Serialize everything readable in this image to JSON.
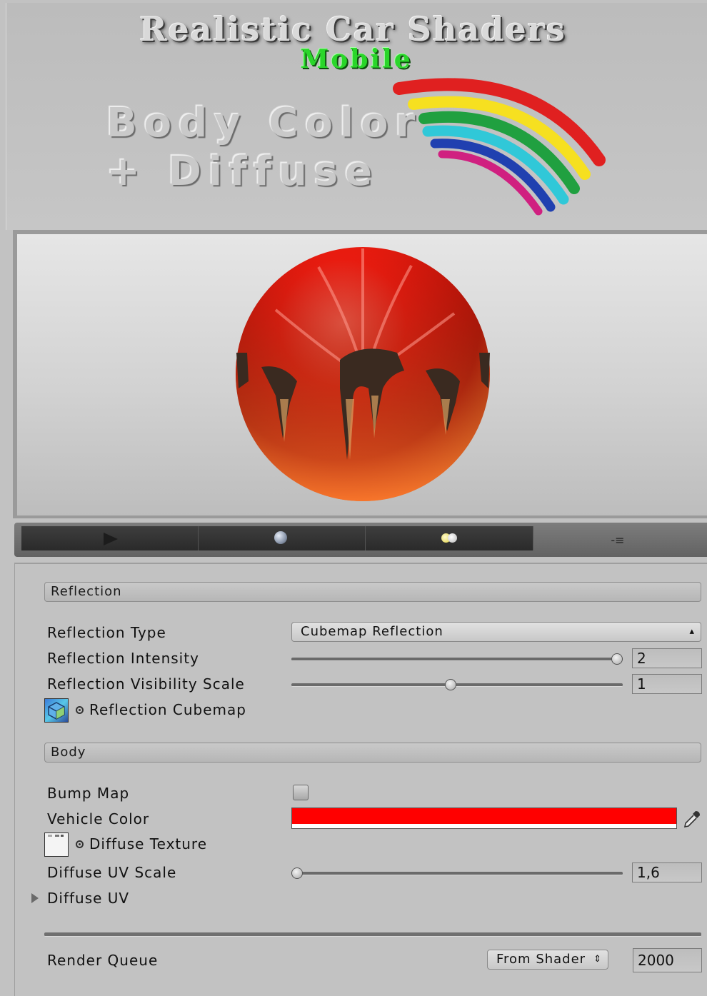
{
  "banner": {
    "title": "Realistic Car Shaders",
    "subtitle": "Mobile",
    "line1": "Body Color",
    "line2": "+ Diffuse"
  },
  "preview": {
    "toolbar": {
      "play": "play-icon",
      "sphere": "sphere-preview-icon",
      "lights": "lights-icon",
      "menu": "-≡"
    }
  },
  "inspector": {
    "reflection_section": "Reflection",
    "reflection_type_label": "Reflection Type",
    "reflection_type_value": "Cubemap Reflection",
    "reflection_intensity_label": "Reflection Intensity",
    "reflection_intensity_value": "2",
    "reflection_intensity_fraction": 1.0,
    "reflection_visibility_label": "Reflection Visibility Scale",
    "reflection_visibility_value": "1",
    "reflection_visibility_fraction": 0.48,
    "reflection_cubemap_label": "Reflection Cubemap",
    "body_section": "Body",
    "bump_map_label": "Bump Map",
    "bump_map_checked": false,
    "vehicle_color_label": "Vehicle Color",
    "vehicle_color": "#ff0000",
    "diffuse_texture_label": "Diffuse Texture",
    "diffuse_uv_scale_label": "Diffuse UV Scale",
    "diffuse_uv_scale_value": "1,6",
    "diffuse_uv_scale_fraction": 0.0,
    "diffuse_uv_label": "Diffuse UV",
    "render_queue_label": "Render Queue",
    "render_queue_mode": "From Shader",
    "render_queue_value": "2000"
  }
}
